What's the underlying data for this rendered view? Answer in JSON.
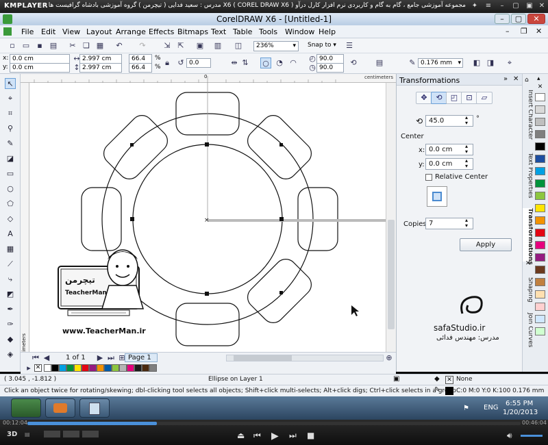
{
  "player": {
    "logo": "KMPLAYER",
    "title": "مجموعه آموزشی جامع ، گام به گام و کاربردی نرم افزار کارل درآو  X6 ( COREL DRAW X6 )  مدرس : سعید فدایی ( تیچرمن ) گروه آموزشی بادشاه گرافیست ها",
    "time_elapsed": "00:12:04",
    "time_total": "00:46:04",
    "progress_fraction": 0.262
  },
  "window": {
    "title": "CorelDRAW X6 - [Untitled-1]"
  },
  "menu": [
    "File",
    "Edit",
    "View",
    "Layout",
    "Arrange",
    "Effects",
    "Bitmaps",
    "Text",
    "Table",
    "Tools",
    "Window",
    "Help"
  ],
  "toolbar": {
    "zoom": "236%",
    "snap_to": "Snap to"
  },
  "property_bar": {
    "x": "0.0 cm",
    "y": "0.0 cm",
    "width": "2.997 cm",
    "height": "2.997 cm",
    "scale_w": "66.4",
    "scale_h": "66.4",
    "scale_unit": "%",
    "rotation": "0.0",
    "start_angle": "90.0",
    "end_angle": "90.0",
    "outline_width": "0.176 mm"
  },
  "ruler": {
    "units": "centimeters",
    "origin_label": "0"
  },
  "page_nav": {
    "page_count": "1 of 1",
    "page_tab": "Page 1"
  },
  "docker": {
    "title": "Transformations",
    "angle": "45.0",
    "degree_symbol": "°",
    "center_label": "Center",
    "x_label": "x:",
    "x_value": "0.0 cm",
    "y_label": "y:",
    "y_value": "0.0 cm",
    "relative_center": "Relative Center",
    "copies_label": "Copies:",
    "copies": "7",
    "apply": "Apply"
  },
  "side_tabs": [
    "Insert Character",
    "Text Properties",
    "Transformations",
    "Shaping",
    "Join Curves"
  ],
  "watermark": {
    "website": "www.TeacherMan.ir",
    "brand": "TeacherMan",
    "safa_site": "safaStudio.ir",
    "safa_teacher": "مدرس: مهندس فدائی"
  },
  "status": {
    "coords": "( 3.045 , -1.812 )",
    "object_info": "Ellipse on Layer 1",
    "fill": "None",
    "hint": "Click an object twice for rotating/skewing; dbl-clicking tool selects all objects; Shift+click multi-selects; Alt+click digs; Ctrl+click selects in a group",
    "outline_info": "C:0 M:0 Y:0 K:100  0.176 mm"
  },
  "taskbar": {
    "language": "ENG",
    "time": "6:55 PM",
    "date": "1/20/2013"
  },
  "palette_colors": [
    "#ffffff",
    "#000000",
    "#00a0e3",
    "#00933c",
    "#ffe500",
    "#e30613",
    "#951b81",
    "#f39200",
    "#005ca9",
    "#8cc63f",
    "#b5b5b5",
    "#e6007e",
    "#1d1d1b",
    "#4a2a10",
    "#7f7f7f"
  ],
  "side_palette_colors": [
    "#ffffff",
    "#d9d9d9",
    "#bfbfbf",
    "#7f7f7f",
    "#000000",
    "#1d4ea1",
    "#00a0e3",
    "#00933c",
    "#8cc63f",
    "#ffe500",
    "#f39200",
    "#e30613",
    "#e6007e",
    "#951b81",
    "#6b3a1f",
    "#c08040",
    "#ffe0b0",
    "#ffd0d0",
    "#d0e8ff",
    "#d0ffd0"
  ]
}
